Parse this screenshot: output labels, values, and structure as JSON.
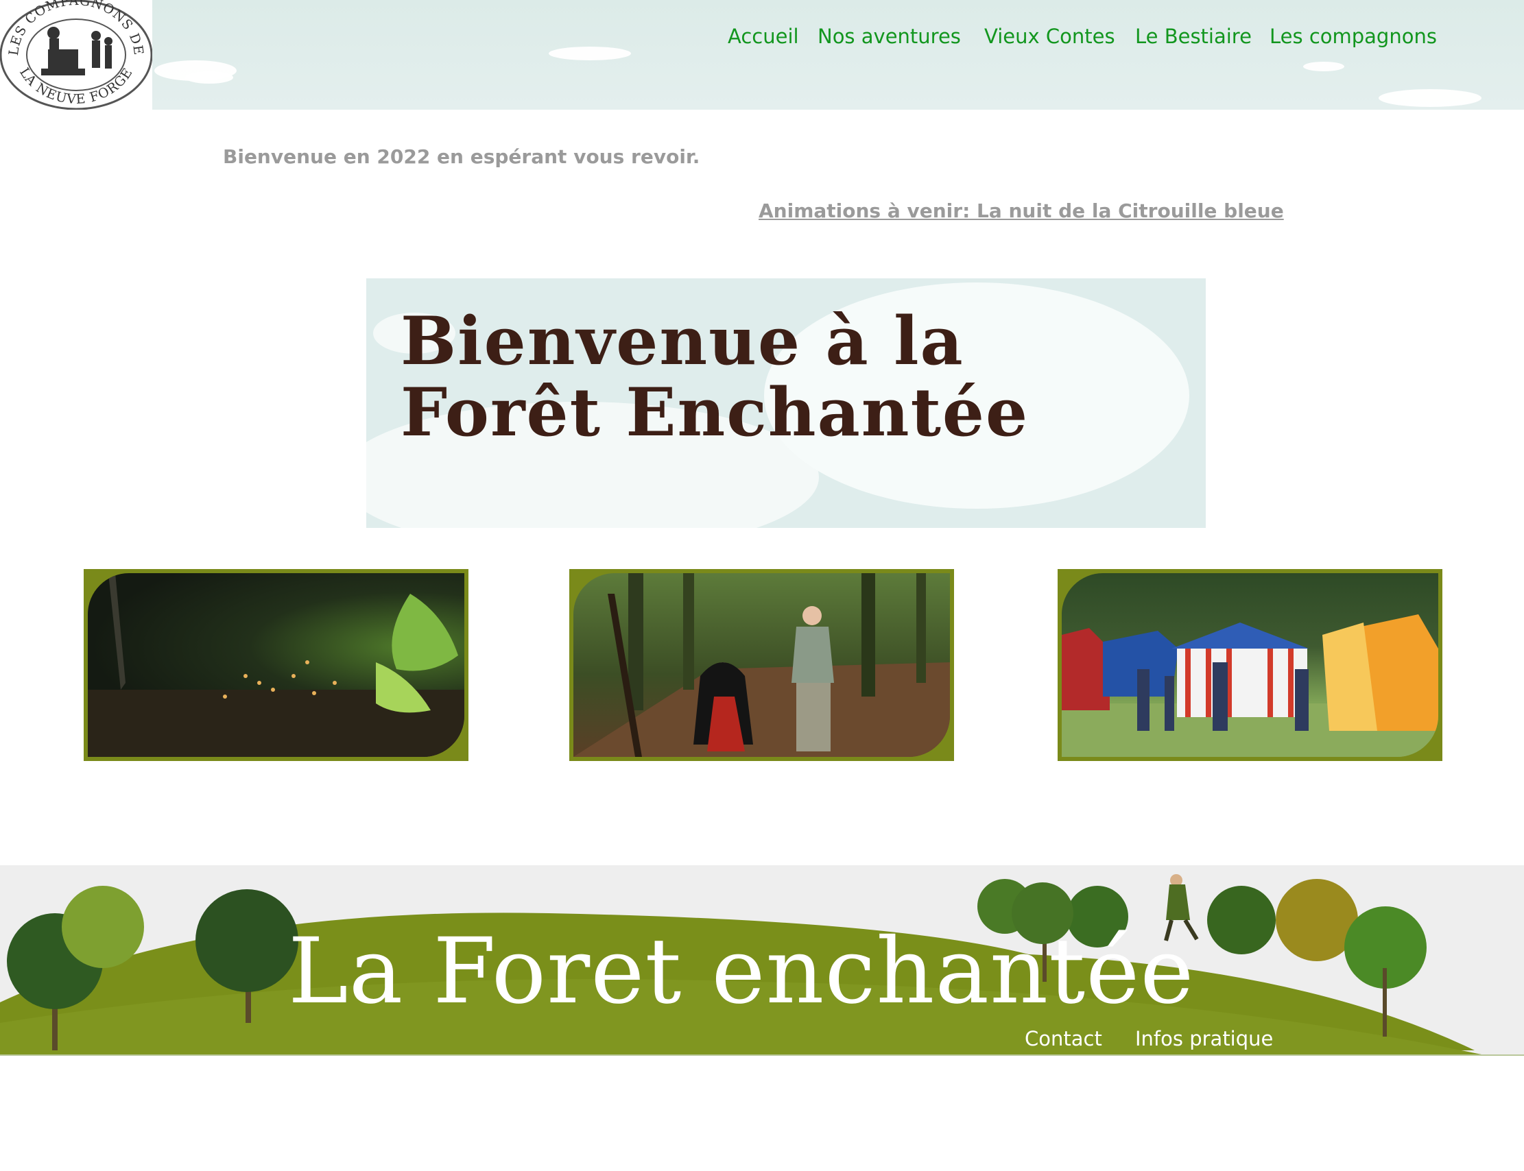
{
  "header": {
    "logo_text_top": "LES COMPAGNONS DE",
    "logo_text_bottom": "LA NEUVE FORGE",
    "nav": [
      {
        "label": "Accueil"
      },
      {
        "label": "Nos aventures"
      },
      {
        "label": "Vieux Contes"
      },
      {
        "label": "Le Bestiaire"
      },
      {
        "label": "Les compagnons"
      }
    ]
  },
  "main": {
    "welcome_text": "Bienvenue en 2022 en espérant vous revoir.",
    "announcement_link": "Animations à venir: La nuit de la Citrouille bleue",
    "banner": {
      "line1": "Bienvenue à la",
      "line2": "Forêt Enchantée"
    }
  },
  "footer": {
    "title": "La Foret enchantée",
    "links": [
      {
        "label": "Contact"
      },
      {
        "label": "Infos pratique"
      }
    ]
  },
  "colors": {
    "nav_green": "#12961e",
    "text_gray": "#9a9a9a",
    "olive": "#7b8d1a",
    "banner_text": "#3d1f16"
  }
}
